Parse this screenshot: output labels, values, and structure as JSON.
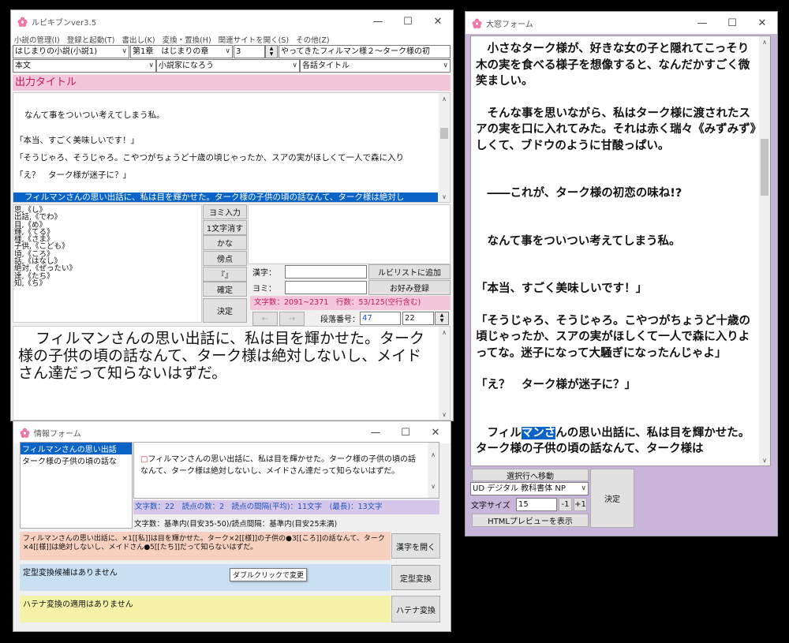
{
  "main": {
    "title": "ルビキブンver3.5",
    "menu": [
      "小説の管理(I)",
      "登録と起動(T)",
      "書出し(K)",
      "変換・置換(H)",
      "関連サイトを開く(S)",
      "その他(Z)"
    ],
    "novel": "はじまりの小説(小説1)",
    "chapter": "第1章　はじまりの章",
    "ep_num": "3",
    "episode": "やってきたフィルマン様２〜ターク様の初",
    "part": "本文",
    "site": "小説家になろう",
    "title_mode": "各話タイトル",
    "output_title": "出力タイトル",
    "text_lines": [
      "なんて事をついつい考えてしまう私。",
      "「本当、すごく美味しいです！」",
      "「そうじゃろ、そうじゃろ。こやつがちょうど十歳の頃じゃったか、スアの実がほしくて一人で森に入り",
      "「え？　ターク様が迷子に？」"
    ],
    "selected_line": "フィルマンさんの思い出話に、私は目を輝かせた。ターク様の子供の頃の話なんて、ターク様は絶対し",
    "ruby_list": [
      "思,《し》",
      "出話,《でわ》",
      "目,《め》",
      "輝,《てる》",
      "様,《さま》",
      "子供,《こども》",
      "頃,《ころ》",
      "話,《はなし》",
      "絶対,《ぜったい》",
      "達,《たち》",
      "知,《ち》"
    ],
    "buttons": [
      "ヨミ入力",
      "1文字消す",
      "かな",
      "傍点",
      "『』",
      "確定",
      "決定"
    ],
    "kanji_label": "漢字：",
    "yomi_label": "ヨミ：",
    "add_ruby": "ルビリストに追加",
    "favorite": "お好み登録",
    "count": "文字数：2091~2371　行数：53/125(空行含む)",
    "para_label": "段落番号：",
    "para_num": "47",
    "para_total": "22",
    "preview": "フィルマンさんの思い出話に、私は目を輝かせた。ターク様の子供の頃の話なんて、ターク様は絶対しないし、メイドさん達だって知らないはずだ。"
  },
  "info": {
    "title": "情報フォーム",
    "list": [
      "フィルマンさんの思い出話",
      "ターク様の子供の頃の話な"
    ],
    "sentence": "フィルマンさんの思い出話に、私は目を輝かせた。ターク様の子供の頃の話なんて、ターク様は絶対しないし、メイドさん達だって知らないはずだ。",
    "stats": "文字数：22　読点の数：2　読点の間隔(平均)：11文字　(最長)：13文字",
    "basis": "文字数：基準内(目安35-50)/読点間隔：基準内(目安25未満)",
    "kanji_line": "フィルマンさんの思い出話に、×1[[私]]は目を輝かせた。ターク×2[[様]]の子供の●3[[ころ]]の話なんて、ターク×4[[様]]は絶対しないし、メイドさん●5[[たち]]だって知らないはずだ。",
    "open_kanji": "漢字を開く",
    "fixed_none": "定型変換候補はありません",
    "tooltip": "ダブルクリックで変更",
    "fixed_btn": "定型変換",
    "hatena_none": "ハテナ変換の適用はありません",
    "hatena_btn": "ハテナ変換"
  },
  "big": {
    "title": "大窓フォーム",
    "paragraphs": [
      [
        "　小さなターク様が、好きな女の子と隠れてこっそり木の実を食べる様子を想像すると、なんだかすごく微笑ましい。"
      ],
      [
        "　そんな事を思いながら、私はターク様に渡されたスアの実を口に入れてみた。それは赤く瑞々《みずみず》しくて、ブドウのように甘酸っぱい。"
      ],
      [
        "　――これが、ターク様の初恋の味ね!?"
      ],
      [
        "　なんて事をついつい考えてしまう私。"
      ],
      [
        "「本当、すごく美味しいです！」"
      ],
      [
        "「そうじゃろ、そうじゃろ。こやつがちょうど十歳の頃じゃったか、スアの実がほしくて一人で森に入りよってな。迷子になって大騒ぎになったんじゃよ」"
      ],
      [
        "「え？　ターク様が迷子に？」"
      ]
    ],
    "last_pre": "　フィル",
    "last_sel": "マンさ",
    "last_post": "んの思い出話に、私は目を輝かせた。ターク様の子供の頃の話なんて、ターク様は",
    "move_btn": "選択行へ移動",
    "font_name": "UD デジタル 教科書体 NP",
    "size_label": "文字サイズ",
    "size_val": "15",
    "minus": "-1",
    "plus": "+1",
    "decide": "決定",
    "html_btn": "HTMLプレビューを表示"
  }
}
